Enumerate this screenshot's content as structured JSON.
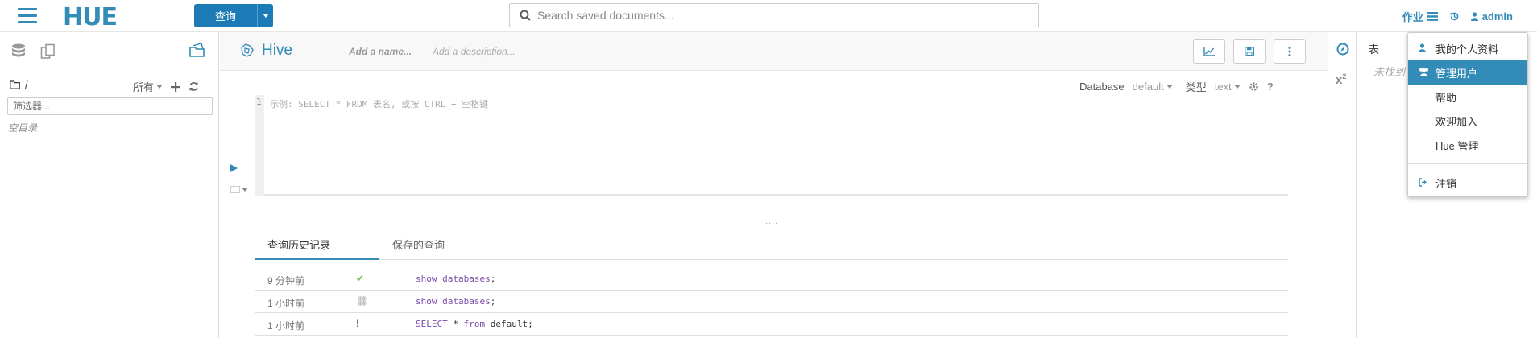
{
  "topnav": {
    "logo": "HUE",
    "query_button": "查询",
    "search_placeholder": "Search saved documents...",
    "jobs_label": "作业",
    "user_label": "admin"
  },
  "left_panel": {
    "path": "/",
    "filter_all": "所有",
    "filter_placeholder": "筛选器...",
    "empty_text": "空目录"
  },
  "editor": {
    "engine": "Hive",
    "name_placeholder": "Add a name...",
    "description_placeholder": "Add a description...",
    "database_label": "Database",
    "database_value": "default",
    "type_label": "类型",
    "type_value": "text",
    "line_number": "1",
    "code_placeholder": "示例: SELECT * FROM 表名, 或按 CTRL + 空格键",
    "resize_handle": "...."
  },
  "tabs": [
    {
      "label": "查询历史记录",
      "active": true
    },
    {
      "label": "保存的查询",
      "active": false
    }
  ],
  "history": [
    {
      "time": "9 分钟前",
      "status": "success",
      "status_icon": "✔",
      "status_color": "#7cb845",
      "code": [
        "show",
        " ",
        "databases",
        ";"
      ]
    },
    {
      "time": "1 小时前",
      "status": "expired",
      "status_icon": "⛓",
      "status_color": "#999999",
      "code": [
        "show",
        " ",
        "databases",
        ";"
      ]
    },
    {
      "time": "1 小时前",
      "status": "error",
      "status_icon": "!",
      "status_color": "#555555",
      "code": [
        "SELECT",
        " * ",
        "from",
        " default;"
      ]
    }
  ],
  "right_panel": {
    "title": "表",
    "not_found": "未找到"
  },
  "user_menu": {
    "items": [
      {
        "label": "我的个人资料",
        "icon": "user-icon",
        "active": false
      },
      {
        "label": "管理用户",
        "icon": "users-icon",
        "active": true
      },
      {
        "label": "帮助",
        "icon": "",
        "active": false
      },
      {
        "label": "欢迎加入",
        "icon": "",
        "active": false
      },
      {
        "label": "Hue 管理",
        "icon": "",
        "active": false
      }
    ],
    "logout_label": "注销"
  },
  "colors": {
    "accent": "#338bb8",
    "primary_button": "#1c7bb7",
    "keyword": "#7a4aa8",
    "success": "#7cb845"
  }
}
